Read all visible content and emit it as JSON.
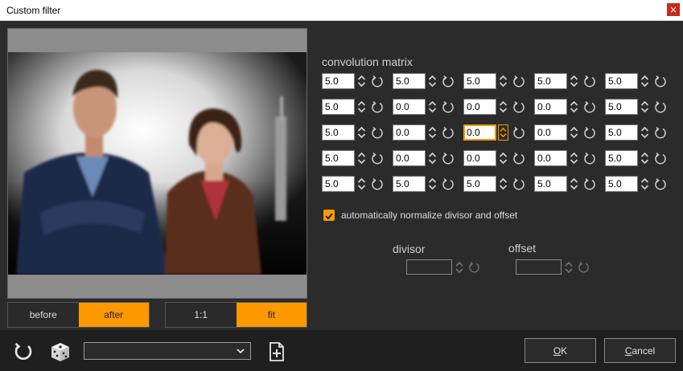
{
  "window": {
    "title": "Custom filter",
    "close_glyph": "×"
  },
  "preview": {
    "toggle_before": "before",
    "toggle_after": "after",
    "toggle_before_active": false,
    "zoom_1to1": "1:1",
    "zoom_fit": "fit",
    "zoom_fit_active": true
  },
  "matrix": {
    "label": "convolution matrix",
    "rows": [
      [
        "5.0",
        "5.0",
        "5.0",
        "5.0",
        "5.0"
      ],
      [
        "5.0",
        "0.0",
        "0.0",
        "0.0",
        "5.0"
      ],
      [
        "5.0",
        "0.0",
        "0.0",
        "0.0",
        "5.0"
      ],
      [
        "5.0",
        "0.0",
        "0.0",
        "0.0",
        "5.0"
      ],
      [
        "5.0",
        "5.0",
        "5.0",
        "5.0",
        "5.0"
      ]
    ],
    "focused_cell": [
      2,
      2
    ]
  },
  "normalize": {
    "label": "automatically normalize divisor and offset",
    "checked": true
  },
  "divisor": {
    "label": "divisor",
    "value": ""
  },
  "offset": {
    "label": "offset",
    "value": ""
  },
  "toolbar": {
    "preset_value": ""
  },
  "buttons": {
    "ok_underline": "O",
    "ok_rest": "K",
    "cancel_underline": "C",
    "cancel_rest": "ancel"
  },
  "colors": {
    "accent": "#ff9900",
    "background": "#2b2b2b",
    "bottom_bar": "#1f1f1f"
  },
  "icons": [
    "close-icon",
    "spin-up-down-icon",
    "reset-icon",
    "checkmark-icon",
    "refresh-icon",
    "dice-icon",
    "chevron-down-icon",
    "add-file-icon"
  ]
}
